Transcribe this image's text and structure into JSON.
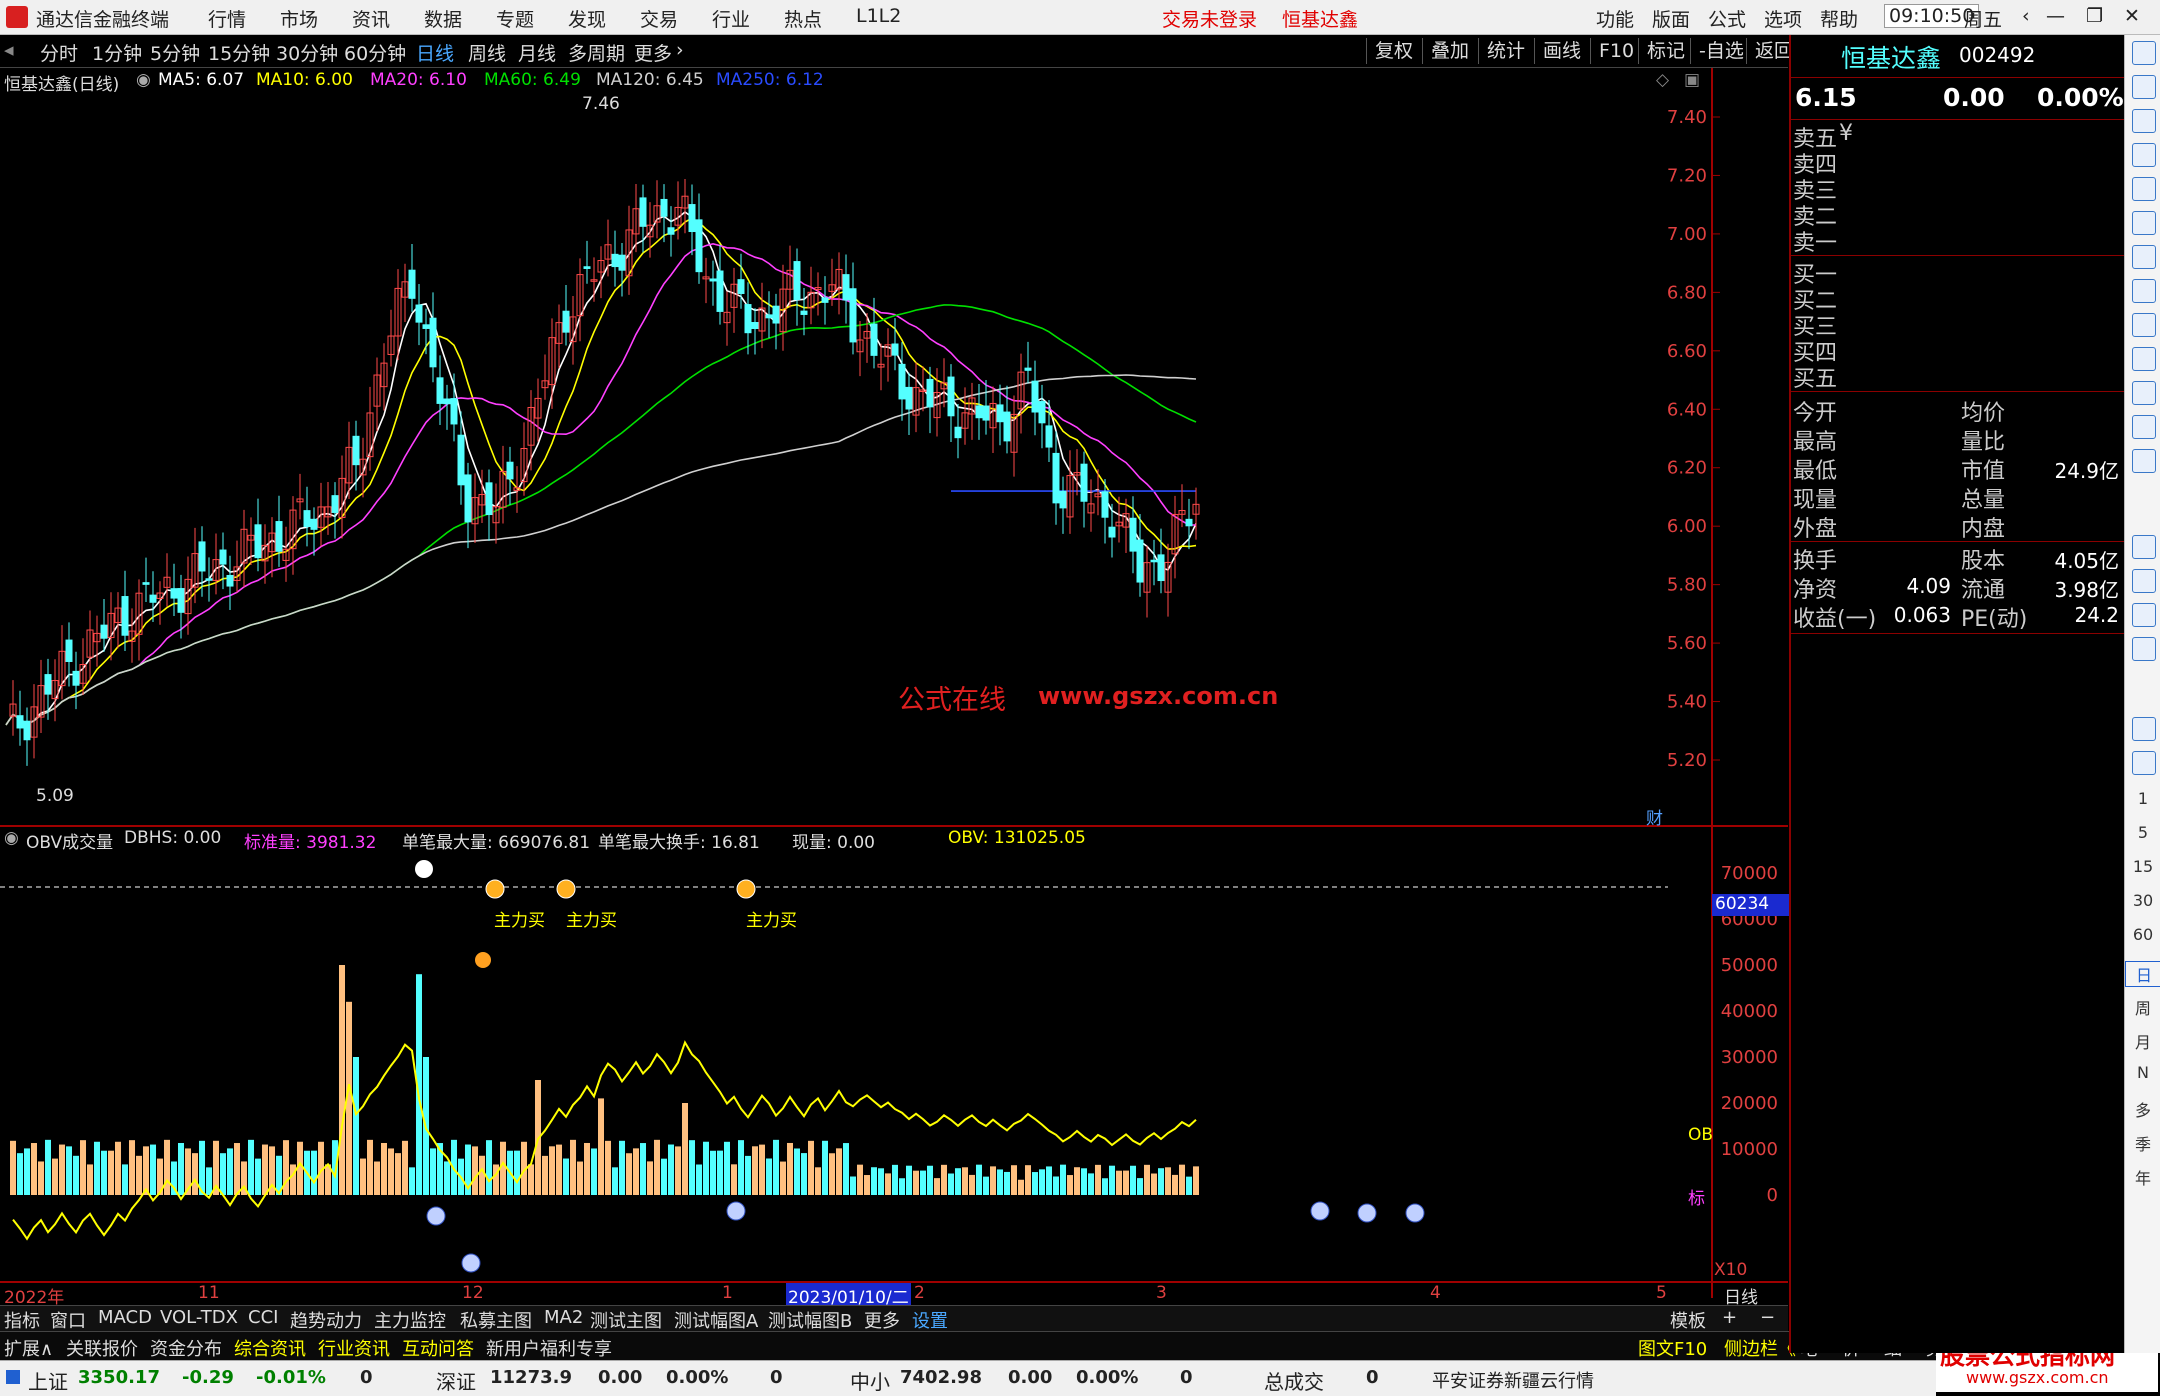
{
  "titlebar": {
    "app_title": "通达信金融终端",
    "menu": [
      "行情",
      "市场",
      "资讯",
      "数据",
      "专题",
      "发现",
      "交易",
      "行业",
      "热点",
      "L1L2"
    ],
    "login_status": "交易未登录",
    "stock_name": "恒基达鑫",
    "right_menu": [
      "功能",
      "版面",
      "公式",
      "选项",
      "帮助"
    ],
    "time": "09:10:50",
    "weekday": "周五"
  },
  "periods": [
    "分时",
    "1分钟",
    "5分钟",
    "15分钟",
    "30分钟",
    "60分钟",
    "日线",
    "周线",
    "月线",
    "多周期",
    "更多"
  ],
  "active_period": "日线",
  "toolbar_right": [
    "复权",
    "叠加",
    "统计",
    "画线",
    "F10",
    "标记",
    "-自选",
    "返回"
  ],
  "main_legend": {
    "name": "恒基达鑫(日线)",
    "ma5": "MA5: 6.07",
    "ma10": "MA10: 6.00",
    "ma20": "MA20: 6.10",
    "ma60": "MA60: 6.49",
    "ma120": "MA120: 6.45",
    "ma250": "MA250: 6.12"
  },
  "price_axis": [
    "7.40",
    "7.20",
    "7.00",
    "6.80",
    "6.60",
    "6.40",
    "6.20",
    "6.00",
    "5.80",
    "5.60",
    "5.40",
    "5.20"
  ],
  "annot_high": "7.46",
  "annot_low": "5.09",
  "watermark_cn": "公式在线",
  "watermark_url": "www.gszx.com.cn",
  "cai_label": "财",
  "sub_legend": {
    "name": "OBV成交量",
    "dbhs": "DBHS: 0.00",
    "std": "标准量: 3981.32",
    "maxvol": "单笔最大量: 669076.81",
    "maxturn": "单笔最大换手: 16.81",
    "cur": "现量: 0.00",
    "obv": "OBV: 131025.05"
  },
  "vol_axis": [
    "70000",
    "60000",
    "50000",
    "40000",
    "30000",
    "20000",
    "10000",
    "0"
  ],
  "vol_marker": "60234",
  "vol_scale": "X10",
  "ob_label": "OB",
  "std_label": "标",
  "buy_labels": [
    "主力买",
    "主力买",
    "主力买"
  ],
  "date_axis": [
    "2022年",
    "11",
    "12",
    "1",
    "2",
    "3",
    "4",
    "5"
  ],
  "date_cursor": "2023/01/10/二",
  "date_period": "日线",
  "indicator_tabs": [
    "指标",
    "窗口",
    "MACD",
    "VOL-TDX",
    "CCI",
    "趋势动力",
    "主力监控",
    "私募主图",
    "MA2",
    "测试主图",
    "测试幅图A",
    "测试幅图B",
    "更多",
    "设置"
  ],
  "template_btn": "模板",
  "plus_btn": "+",
  "minus_btn": "−",
  "info_tabs": [
    "扩展∧",
    "关联报价",
    "资金分布",
    "综合资讯",
    "行业资讯",
    "互动问答",
    "新用户福利专享"
  ],
  "info_right": [
    "图文F10",
    "侧边栏《",
    "笔",
    "价",
    "细",
    "势"
  ],
  "site_logo": "股票公式指标网",
  "site_url": "www.gszx.com.cn",
  "status": {
    "sh_name": "上证",
    "sh_val": "3350.17",
    "sh_chg": "-0.29",
    "sh_pct": "-0.01%",
    "sh_amt": "0",
    "sz_name": "深证",
    "sz_val": "11273.9",
    "sz_chg": "0.00",
    "sz_pct": "0.00%",
    "sz_amt": "0",
    "zx_name": "中小",
    "zx_val": "7402.98",
    "zx_chg": "0.00",
    "zx_pct": "0.00%",
    "zx_amt": "0",
    "total_name": "总成交",
    "total_val": "0",
    "broker": "平安证券新疆云行情"
  },
  "quote": {
    "name": "恒基达鑫",
    "code": "002492",
    "price": "6.15",
    "change": "0.00",
    "pct": "0.00%",
    "sell_labels": [
      "卖五",
      "卖四",
      "卖三",
      "卖二",
      "卖一"
    ],
    "buy_labels": [
      "买一",
      "买二",
      "买三",
      "买四",
      "买五"
    ],
    "yen": "¥",
    "left_labels": [
      "今开",
      "最高",
      "最低",
      "现量",
      "外盘"
    ],
    "right_labels": [
      "均价",
      "量比",
      "市值",
      "总量",
      "内盘"
    ],
    "mkt_value": "24.9亿",
    "fin_left_labels": [
      "换手",
      "净资",
      "收益(一)"
    ],
    "fin_left_values": [
      "",
      "4.09",
      "0.063"
    ],
    "fin_right_labels": [
      "股本",
      "流通",
      "PE(动)"
    ],
    "fin_right_values": [
      "4.05亿",
      "3.98亿",
      "24.2"
    ]
  },
  "side_tools": [
    "1",
    "5",
    "15",
    "30",
    "60",
    "日",
    "周",
    "月",
    "N",
    "多",
    "季",
    "年"
  ],
  "colors": {
    "up": "#ff4a4a",
    "down": "#54ffff",
    "ma5": "#ffffff",
    "ma10": "#ffff00",
    "ma20": "#ff40ff",
    "ma60": "#00e000",
    "ma120": "#d0d0d0",
    "ma250": "#2a4cff",
    "vol_up": "#ffc080",
    "obv": "#ffff00"
  }
}
